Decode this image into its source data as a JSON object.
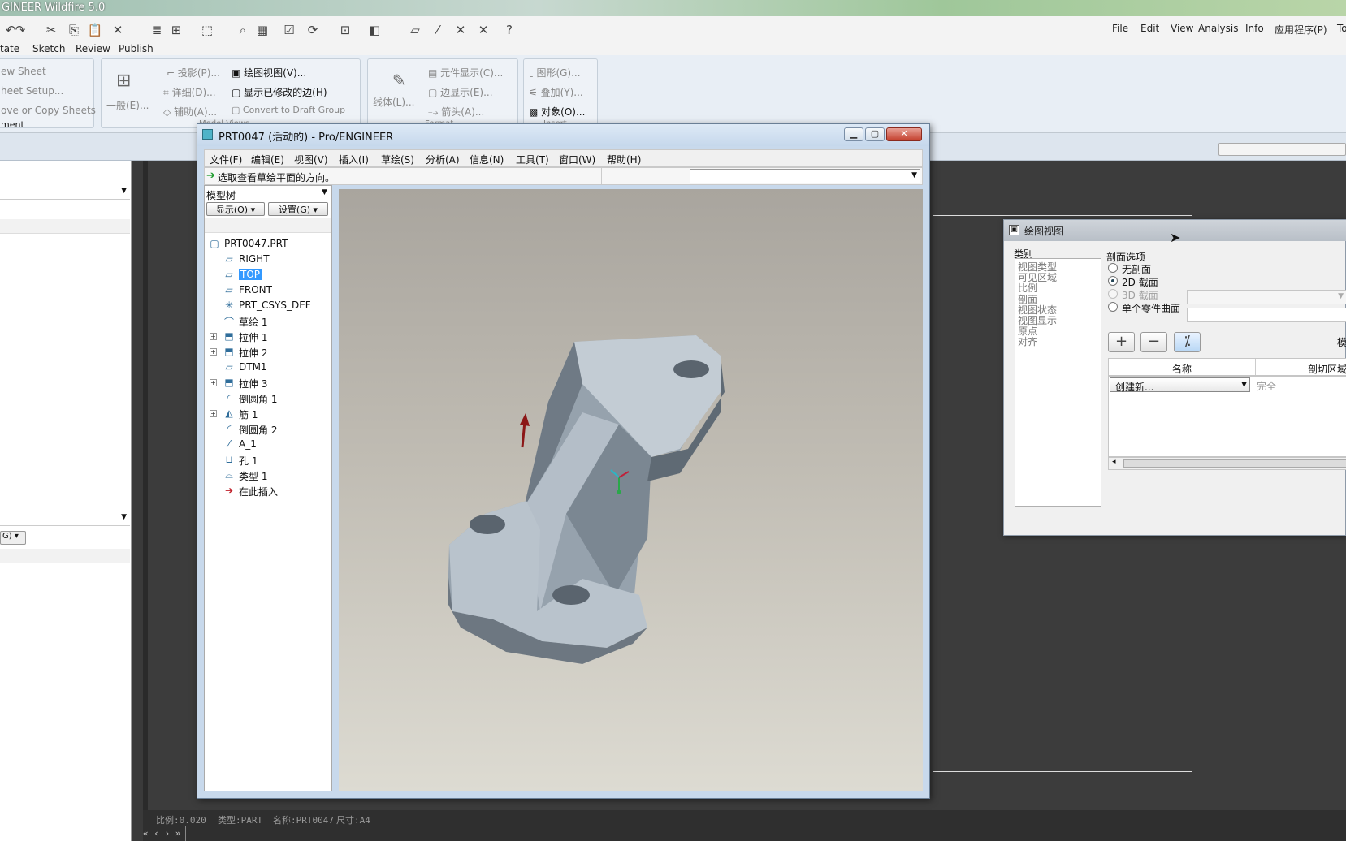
{
  "app": {
    "title": "GINEER Wildfire 5.0",
    "tabs": [
      "tate",
      "Sketch",
      "Review",
      "Publish"
    ],
    "menu_right": [
      "File",
      "Edit",
      "View",
      "Analysis",
      "Info",
      "应用程序(P)",
      "To"
    ]
  },
  "ribbon": {
    "group1": [
      "ew Sheet",
      "heet Setup...",
      "ove or Copy Sheets",
      "ment"
    ],
    "model_views": {
      "general": "一般(E)...",
      "items": [
        "投影(P)...",
        "详细(D)...",
        "辅助(A)..."
      ],
      "items2": [
        "绘图视图(V)...",
        "显示已修改的边(H)",
        "Convert to Draft Group"
      ],
      "label": "Model Views"
    },
    "format": {
      "line": "线体(L)...",
      "items": [
        "元件显示(C)...",
        "边显示(E)...",
        "箭头(A)..."
      ],
      "label": "Format"
    },
    "insert": {
      "items": [
        "图形(G)...",
        "叠加(Y)...",
        "对象(O)..."
      ],
      "label": "Insert"
    }
  },
  "left_panel": {
    "dropdown_label": "G)"
  },
  "status_bar": {
    "scale": "比例:0.020",
    "type": "类型:PART",
    "name": "名称:PRT0047",
    "size": "尺寸:A4"
  },
  "proe_window": {
    "title": "PRT0047 (活动的) - Pro/ENGINEER",
    "menu": [
      "文件(F)",
      "编辑(E)",
      "视图(V)",
      "插入(I)",
      "草绘(S)",
      "分析(A)",
      "信息(N)",
      "工具(T)",
      "窗口(W)",
      "帮助(H)"
    ],
    "message": "选取查看草绘平面的方向。",
    "tree_header": "模型树",
    "show_btn": "显示(O)",
    "settings_btn": "设置(G)",
    "tree": [
      {
        "label": "PRT0047.PRT",
        "icon": "part-icon",
        "exp": false
      },
      {
        "label": "RIGHT",
        "icon": "datum-plane-icon",
        "exp": false
      },
      {
        "label": "TOP",
        "icon": "datum-plane-icon",
        "exp": false,
        "selected": true
      },
      {
        "label": "FRONT",
        "icon": "datum-plane-icon",
        "exp": false
      },
      {
        "label": "PRT_CSYS_DEF",
        "icon": "csys-icon",
        "exp": false
      },
      {
        "label": "草绘 1",
        "icon": "sketch-icon",
        "exp": false
      },
      {
        "label": "拉伸 1",
        "icon": "extrude-icon",
        "exp": true
      },
      {
        "label": "拉伸 2",
        "icon": "extrude-icon",
        "exp": true
      },
      {
        "label": "DTM1",
        "icon": "datum-plane-icon",
        "exp": false
      },
      {
        "label": "拉伸 3",
        "icon": "extrude-icon",
        "exp": true
      },
      {
        "label": "倒圆角 1",
        "icon": "round-icon",
        "exp": false
      },
      {
        "label": "筋 1",
        "icon": "rib-icon",
        "exp": true
      },
      {
        "label": "倒圆角 2",
        "icon": "round-icon",
        "exp": false
      },
      {
        "label": "A_1",
        "icon": "axis-icon",
        "exp": false
      },
      {
        "label": "孔 1",
        "icon": "hole-icon",
        "exp": false
      },
      {
        "label": "类型 1",
        "icon": "pattern-icon",
        "exp": false
      },
      {
        "label": "在此插入",
        "icon": "insert-here-icon",
        "exp": false
      }
    ]
  },
  "dialog": {
    "title": "绘图视图",
    "category_label": "类别",
    "categories": [
      "视图类型",
      "可见区域",
      "比例",
      "剖面",
      "视图状态",
      "视图显示",
      "原点",
      "对齐"
    ],
    "section_options_label": "剖面选项",
    "options": [
      {
        "label": "无剖面",
        "checked": false,
        "disabled": false
      },
      {
        "label": "2D 截面",
        "checked": true,
        "disabled": false
      },
      {
        "label": "3D 截面",
        "checked": false,
        "disabled": true
      },
      {
        "label": "单个零件曲面",
        "checked": false,
        "disabled": false
      }
    ],
    "model_label": "模",
    "col_name": "名称",
    "col_cut_region": "剖切区域",
    "create_new": "创建新...",
    "complete": "完全"
  },
  "colors": {
    "selection": "#3399ff",
    "part_body": "#9aa7b4",
    "viewport_top": "#a9a59e",
    "viewport_bottom": "#dddbd2"
  }
}
